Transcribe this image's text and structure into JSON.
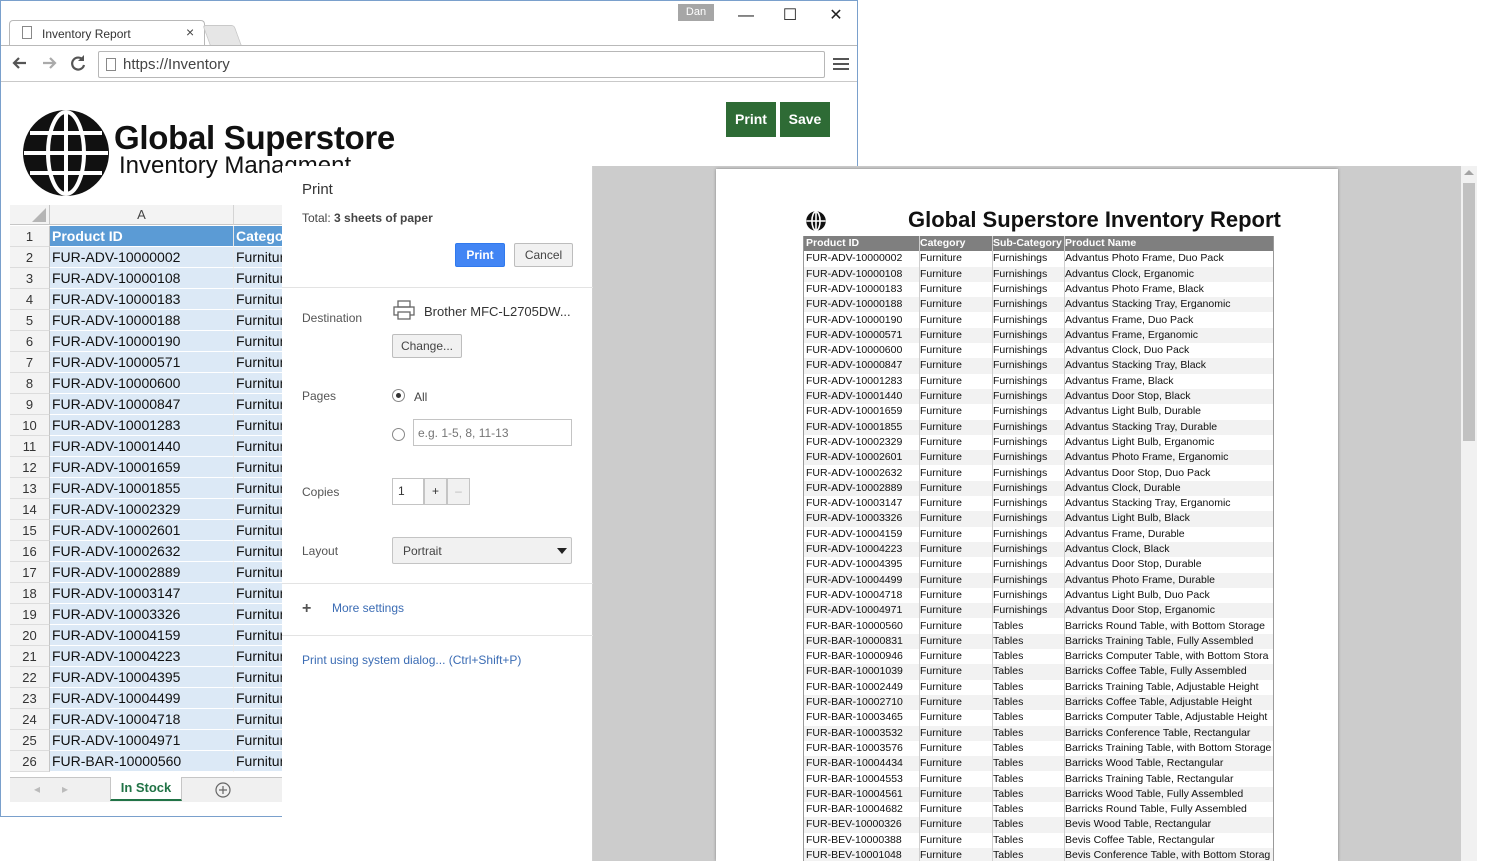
{
  "browser": {
    "tab_title": "Inventory Report",
    "tab_close": "×",
    "user_badge": "Dan",
    "address": "https://Inventory",
    "win_minimize": "—",
    "win_maximize": "☐",
    "win_close": "✕"
  },
  "page": {
    "logo_title": "Global Superstore",
    "logo_subtitle": "Inventory Managment",
    "print_button": "Print",
    "save_button": "Save"
  },
  "sheet": {
    "col_a": "A",
    "header_product_id": "Product ID",
    "header_category": "Category",
    "rows": [
      {
        "n": "2",
        "id": "FUR-ADV-10000002",
        "cat": "Furniture"
      },
      {
        "n": "3",
        "id": "FUR-ADV-10000108",
        "cat": "Furniture"
      },
      {
        "n": "4",
        "id": "FUR-ADV-10000183",
        "cat": "Furniture"
      },
      {
        "n": "5",
        "id": "FUR-ADV-10000188",
        "cat": "Furniture"
      },
      {
        "n": "6",
        "id": "FUR-ADV-10000190",
        "cat": "Furniture"
      },
      {
        "n": "7",
        "id": "FUR-ADV-10000571",
        "cat": "Furniture"
      },
      {
        "n": "8",
        "id": "FUR-ADV-10000600",
        "cat": "Furniture"
      },
      {
        "n": "9",
        "id": "FUR-ADV-10000847",
        "cat": "Furniture"
      },
      {
        "n": "10",
        "id": "FUR-ADV-10001283",
        "cat": "Furniture"
      },
      {
        "n": "11",
        "id": "FUR-ADV-10001440",
        "cat": "Furniture"
      },
      {
        "n": "12",
        "id": "FUR-ADV-10001659",
        "cat": "Furniture"
      },
      {
        "n": "13",
        "id": "FUR-ADV-10001855",
        "cat": "Furniture"
      },
      {
        "n": "14",
        "id": "FUR-ADV-10002329",
        "cat": "Furniture"
      },
      {
        "n": "15",
        "id": "FUR-ADV-10002601",
        "cat": "Furniture"
      },
      {
        "n": "16",
        "id": "FUR-ADV-10002632",
        "cat": "Furniture"
      },
      {
        "n": "17",
        "id": "FUR-ADV-10002889",
        "cat": "Furniture"
      },
      {
        "n": "18",
        "id": "FUR-ADV-10003147",
        "cat": "Furniture"
      },
      {
        "n": "19",
        "id": "FUR-ADV-10003326",
        "cat": "Furniture"
      },
      {
        "n": "20",
        "id": "FUR-ADV-10004159",
        "cat": "Furniture"
      },
      {
        "n": "21",
        "id": "FUR-ADV-10004223",
        "cat": "Furniture"
      },
      {
        "n": "22",
        "id": "FUR-ADV-10004395",
        "cat": "Furniture"
      },
      {
        "n": "23",
        "id": "FUR-ADV-10004499",
        "cat": "Furniture"
      },
      {
        "n": "24",
        "id": "FUR-ADV-10004718",
        "cat": "Furniture"
      },
      {
        "n": "25",
        "id": "FUR-ADV-10004971",
        "cat": "Furniture"
      },
      {
        "n": "26",
        "id": "FUR-BAR-10000560",
        "cat": "Furniture"
      }
    ],
    "sheet_tab": "In Stock"
  },
  "print_dialog": {
    "title": "Print",
    "total_label": "Total:",
    "total_value": "3 sheets of paper",
    "print_button": "Print",
    "cancel_button": "Cancel",
    "destination_label": "Destination",
    "destination_value": "Brother MFC-L2705DW...",
    "change_button": "Change...",
    "pages_label": "Pages",
    "pages_all": "All",
    "pages_placeholder": "e.g. 1-5, 8, 11-13",
    "copies_label": "Copies",
    "copies_value": "1",
    "copies_plus": "+",
    "copies_minus": "–",
    "layout_label": "Layout",
    "layout_value": "Portrait",
    "more_settings": "More settings",
    "system_dialog": "Print using system dialog... (Ctrl+Shift+P)"
  },
  "preview": {
    "title": "Global Superstore Inventory Report",
    "headers": [
      "Product ID",
      "Category",
      "Sub-Category",
      "Product Name"
    ],
    "rows": [
      [
        "FUR-ADV-10000002",
        "Furniture",
        "Furnishings",
        "Advantus Photo Frame, Duo Pack"
      ],
      [
        "FUR-ADV-10000108",
        "Furniture",
        "Furnishings",
        "Advantus Clock, Erganomic"
      ],
      [
        "FUR-ADV-10000183",
        "Furniture",
        "Furnishings",
        "Advantus Photo Frame, Black"
      ],
      [
        "FUR-ADV-10000188",
        "Furniture",
        "Furnishings",
        "Advantus Stacking Tray, Erganomic"
      ],
      [
        "FUR-ADV-10000190",
        "Furniture",
        "Furnishings",
        "Advantus Frame, Duo Pack"
      ],
      [
        "FUR-ADV-10000571",
        "Furniture",
        "Furnishings",
        "Advantus Frame, Erganomic"
      ],
      [
        "FUR-ADV-10000600",
        "Furniture",
        "Furnishings",
        "Advantus Clock, Duo Pack"
      ],
      [
        "FUR-ADV-10000847",
        "Furniture",
        "Furnishings",
        "Advantus Stacking Tray, Black"
      ],
      [
        "FUR-ADV-10001283",
        "Furniture",
        "Furnishings",
        "Advantus Frame, Black"
      ],
      [
        "FUR-ADV-10001440",
        "Furniture",
        "Furnishings",
        "Advantus Door Stop, Black"
      ],
      [
        "FUR-ADV-10001659",
        "Furniture",
        "Furnishings",
        "Advantus Light Bulb, Durable"
      ],
      [
        "FUR-ADV-10001855",
        "Furniture",
        "Furnishings",
        "Advantus Stacking Tray, Durable"
      ],
      [
        "FUR-ADV-10002329",
        "Furniture",
        "Furnishings",
        "Advantus Light Bulb, Erganomic"
      ],
      [
        "FUR-ADV-10002601",
        "Furniture",
        "Furnishings",
        "Advantus Photo Frame, Erganomic"
      ],
      [
        "FUR-ADV-10002632",
        "Furniture",
        "Furnishings",
        "Advantus Door Stop, Duo Pack"
      ],
      [
        "FUR-ADV-10002889",
        "Furniture",
        "Furnishings",
        "Advantus Clock, Durable"
      ],
      [
        "FUR-ADV-10003147",
        "Furniture",
        "Furnishings",
        "Advantus Stacking Tray, Erganomic"
      ],
      [
        "FUR-ADV-10003326",
        "Furniture",
        "Furnishings",
        "Advantus Light Bulb, Black"
      ],
      [
        "FUR-ADV-10004159",
        "Furniture",
        "Furnishings",
        "Advantus Frame, Durable"
      ],
      [
        "FUR-ADV-10004223",
        "Furniture",
        "Furnishings",
        "Advantus Clock, Black"
      ],
      [
        "FUR-ADV-10004395",
        "Furniture",
        "Furnishings",
        "Advantus Door Stop, Durable"
      ],
      [
        "FUR-ADV-10004499",
        "Furniture",
        "Furnishings",
        "Advantus Photo Frame, Durable"
      ],
      [
        "FUR-ADV-10004718",
        "Furniture",
        "Furnishings",
        "Advantus Light Bulb, Duo Pack"
      ],
      [
        "FUR-ADV-10004971",
        "Furniture",
        "Furnishings",
        "Advantus Door Stop, Erganomic"
      ],
      [
        "FUR-BAR-10000560",
        "Furniture",
        "Tables",
        "Barricks Round Table, with Bottom Storage"
      ],
      [
        "FUR-BAR-10000831",
        "Furniture",
        "Tables",
        "Barricks Training Table, Fully Assembled"
      ],
      [
        "FUR-BAR-10000946",
        "Furniture",
        "Tables",
        "Barricks Computer Table, with Bottom Stora"
      ],
      [
        "FUR-BAR-10001039",
        "Furniture",
        "Tables",
        "Barricks Coffee Table, Fully Assembled"
      ],
      [
        "FUR-BAR-10002449",
        "Furniture",
        "Tables",
        "Barricks Training Table, Adjustable Height"
      ],
      [
        "FUR-BAR-10002710",
        "Furniture",
        "Tables",
        "Barricks Coffee Table, Adjustable Height"
      ],
      [
        "FUR-BAR-10003465",
        "Furniture",
        "Tables",
        "Barricks Computer Table, Adjustable Height"
      ],
      [
        "FUR-BAR-10003532",
        "Furniture",
        "Tables",
        "Barricks Conference Table, Rectangular"
      ],
      [
        "FUR-BAR-10003576",
        "Furniture",
        "Tables",
        "Barricks Training Table, with Bottom Storage"
      ],
      [
        "FUR-BAR-10004434",
        "Furniture",
        "Tables",
        "Barricks Wood Table, Rectangular"
      ],
      [
        "FUR-BAR-10004553",
        "Furniture",
        "Tables",
        "Barricks Training Table, Rectangular"
      ],
      [
        "FUR-BAR-10004561",
        "Furniture",
        "Tables",
        "Barricks Wood Table, Fully Assembled"
      ],
      [
        "FUR-BAR-10004682",
        "Furniture",
        "Tables",
        "Barricks Round Table, Fully Assembled"
      ],
      [
        "FUR-BEV-10000326",
        "Furniture",
        "Tables",
        "Bevis Wood Table, Rectangular"
      ],
      [
        "FUR-BEV-10000388",
        "Furniture",
        "Tables",
        "Bevis Coffee Table, Rectangular"
      ],
      [
        "FUR-BEV-10001048",
        "Furniture",
        "Tables",
        "Bevis Conference Table, with Bottom Storag"
      ]
    ]
  },
  "colors": {
    "accent_green": "#2e6b35",
    "print_blue": "#4285f4",
    "sheet_header_blue": "#5b9bd5",
    "sheet_cell_blue": "#dce9f6",
    "link_blue": "#3b6cb4"
  }
}
